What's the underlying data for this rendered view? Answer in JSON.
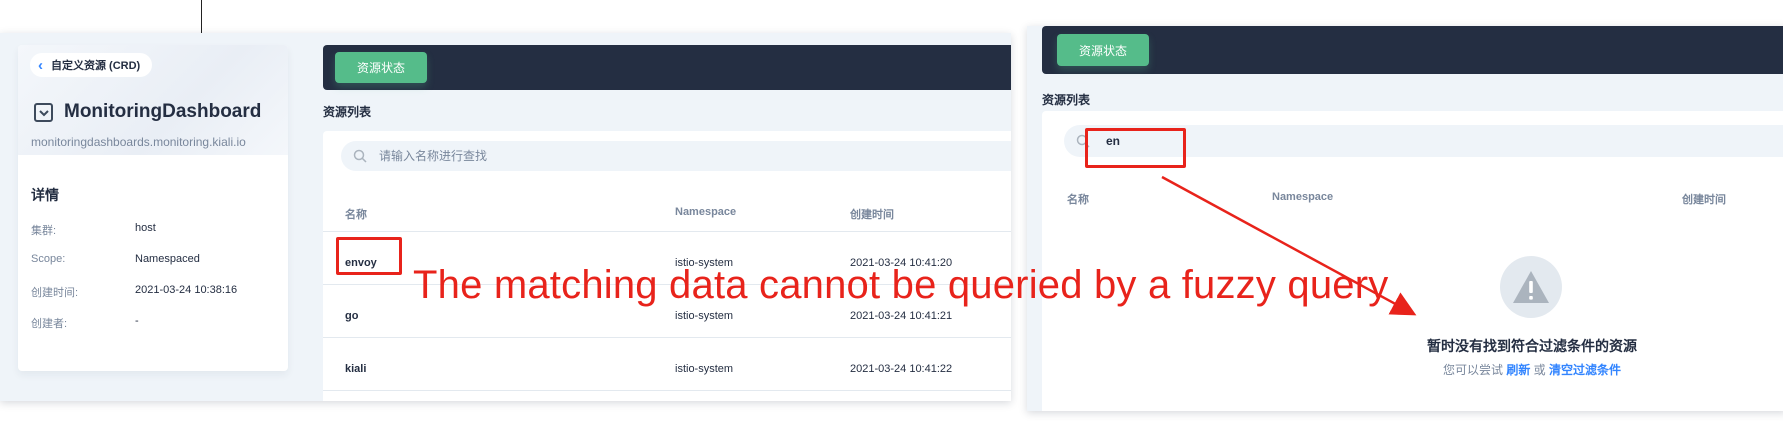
{
  "left_panel": {
    "back_label": "自定义资源 (CRD)",
    "crd_name": "MonitoringDashboard",
    "crd_group": "monitoringdashboards.monitoring.kiali.io",
    "details_title": "详情",
    "details": [
      {
        "label": "集群:",
        "value": "host"
      },
      {
        "label": "Scope:",
        "value": "Namespaced"
      },
      {
        "label": "创建时间:",
        "value": "2021-03-24 10:38:16"
      },
      {
        "label": "创建者:",
        "value": "-"
      }
    ],
    "status_button": "资源状态",
    "list_title": "资源列表",
    "search_placeholder": "请输入名称进行查找",
    "columns": {
      "name": "名称",
      "namespace": "Namespace",
      "created": "创建时间"
    },
    "rows": [
      {
        "name": "envoy",
        "namespace": "istio-system",
        "created": "2021-03-24 10:41:20"
      },
      {
        "name": "go",
        "namespace": "istio-system",
        "created": "2021-03-24 10:41:21"
      },
      {
        "name": "kiali",
        "namespace": "istio-system",
        "created": "2021-03-24 10:41:22"
      }
    ]
  },
  "right_panel": {
    "status_button": "资源状态",
    "list_title": "资源列表",
    "search_value": "en",
    "columns": {
      "name": "名称",
      "namespace": "Namespace",
      "created": "创建时间"
    },
    "empty_title": "暂时没有找到符合过滤条件的资源",
    "empty_hint_prefix": "您可以尝试",
    "refresh_link": "刷新",
    "hint_or": "或",
    "clear_filter_link": "清空过滤条件"
  },
  "annotation": {
    "text": "The matching data cannot be queried by a fuzzy query",
    "color": "#e8231b"
  },
  "colors": {
    "dark_bar": "#242e42",
    "green": "#55bc8a",
    "link": "#3385ff",
    "page_bg": "#eff4f9"
  },
  "icons": [
    "chevron-left-icon",
    "crd-icon",
    "search-icon",
    "warning-icon",
    "arrow-icon"
  ]
}
